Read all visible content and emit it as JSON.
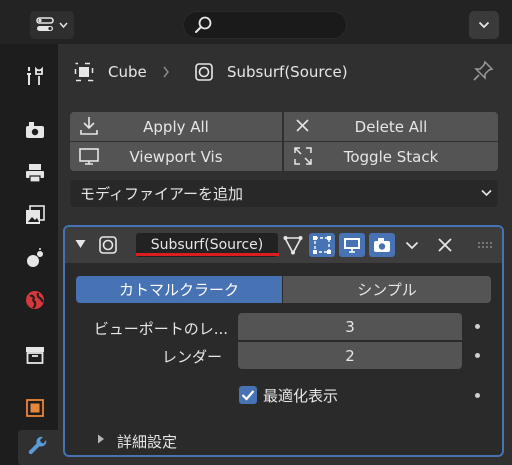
{
  "header": {
    "editor_type_icon": "properties-editor-icon",
    "search_placeholder": "",
    "options_icon": "chevron-down-icon"
  },
  "tabs": [
    {
      "name": "tool",
      "icon": "tool-icon"
    },
    {
      "name": "render",
      "icon": "render-icon"
    },
    {
      "name": "output",
      "icon": "output-icon"
    },
    {
      "name": "view-layer",
      "icon": "view-layer-icon"
    },
    {
      "name": "scene",
      "icon": "scene-icon"
    },
    {
      "name": "world",
      "icon": "world-icon"
    },
    {
      "name": "collection",
      "icon": "collection-icon"
    },
    {
      "name": "object",
      "icon": "object-icon"
    },
    {
      "name": "modifiers",
      "icon": "wrench-icon",
      "active": true
    }
  ],
  "breadcrumb": {
    "object": "Cube",
    "modifier": "Subsurf(Source)"
  },
  "actions": {
    "apply_all": "Apply All",
    "delete_all": "Delete All",
    "viewport_vis": "Viewport Vis",
    "toggle_stack": "Toggle Stack"
  },
  "add_modifier": "モディファイアーを追加",
  "modifier": {
    "name": "Subsurf(Source)",
    "mode_tabs": [
      "カトマルクラーク",
      "シンプル"
    ],
    "active_mode": 0,
    "fields": [
      {
        "label": "ビューポートのレ...",
        "value": "3"
      },
      {
        "label": "レンダー",
        "value": "2"
      }
    ],
    "optimal_display_label": "最適化表示",
    "optimal_display_checked": true,
    "advanced_label": "詳細設定"
  },
  "colors": {
    "accent": "#4772b3",
    "highlight_underline": "#d81e1e",
    "panel": "#303030",
    "button": "#545454"
  }
}
